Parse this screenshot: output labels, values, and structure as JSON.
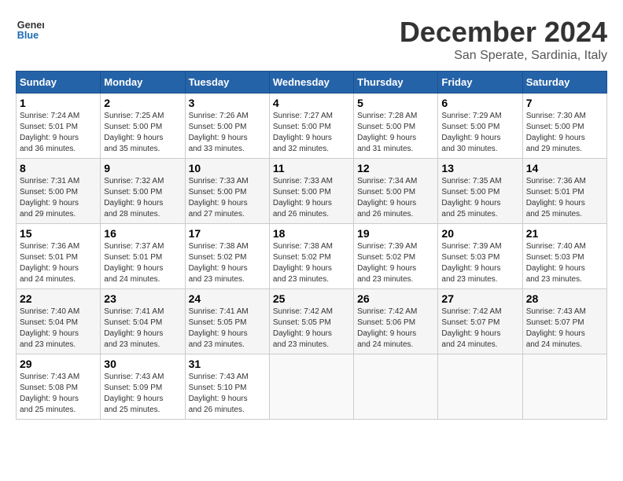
{
  "logo": {
    "line1": "General",
    "line2": "Blue"
  },
  "title": "December 2024",
  "subtitle": "San Sperate, Sardinia, Italy",
  "days_of_week": [
    "Sunday",
    "Monday",
    "Tuesday",
    "Wednesday",
    "Thursday",
    "Friday",
    "Saturday"
  ],
  "weeks": [
    [
      {
        "day": 1,
        "info": "Sunrise: 7:24 AM\nSunset: 5:01 PM\nDaylight: 9 hours\nand 36 minutes."
      },
      {
        "day": 2,
        "info": "Sunrise: 7:25 AM\nSunset: 5:00 PM\nDaylight: 9 hours\nand 35 minutes."
      },
      {
        "day": 3,
        "info": "Sunrise: 7:26 AM\nSunset: 5:00 PM\nDaylight: 9 hours\nand 33 minutes."
      },
      {
        "day": 4,
        "info": "Sunrise: 7:27 AM\nSunset: 5:00 PM\nDaylight: 9 hours\nand 32 minutes."
      },
      {
        "day": 5,
        "info": "Sunrise: 7:28 AM\nSunset: 5:00 PM\nDaylight: 9 hours\nand 31 minutes."
      },
      {
        "day": 6,
        "info": "Sunrise: 7:29 AM\nSunset: 5:00 PM\nDaylight: 9 hours\nand 30 minutes."
      },
      {
        "day": 7,
        "info": "Sunrise: 7:30 AM\nSunset: 5:00 PM\nDaylight: 9 hours\nand 29 minutes."
      }
    ],
    [
      {
        "day": 8,
        "info": "Sunrise: 7:31 AM\nSunset: 5:00 PM\nDaylight: 9 hours\nand 29 minutes."
      },
      {
        "day": 9,
        "info": "Sunrise: 7:32 AM\nSunset: 5:00 PM\nDaylight: 9 hours\nand 28 minutes."
      },
      {
        "day": 10,
        "info": "Sunrise: 7:33 AM\nSunset: 5:00 PM\nDaylight: 9 hours\nand 27 minutes."
      },
      {
        "day": 11,
        "info": "Sunrise: 7:33 AM\nSunset: 5:00 PM\nDaylight: 9 hours\nand 26 minutes."
      },
      {
        "day": 12,
        "info": "Sunrise: 7:34 AM\nSunset: 5:00 PM\nDaylight: 9 hours\nand 26 minutes."
      },
      {
        "day": 13,
        "info": "Sunrise: 7:35 AM\nSunset: 5:00 PM\nDaylight: 9 hours\nand 25 minutes."
      },
      {
        "day": 14,
        "info": "Sunrise: 7:36 AM\nSunset: 5:01 PM\nDaylight: 9 hours\nand 25 minutes."
      }
    ],
    [
      {
        "day": 15,
        "info": "Sunrise: 7:36 AM\nSunset: 5:01 PM\nDaylight: 9 hours\nand 24 minutes."
      },
      {
        "day": 16,
        "info": "Sunrise: 7:37 AM\nSunset: 5:01 PM\nDaylight: 9 hours\nand 24 minutes."
      },
      {
        "day": 17,
        "info": "Sunrise: 7:38 AM\nSunset: 5:02 PM\nDaylight: 9 hours\nand 23 minutes."
      },
      {
        "day": 18,
        "info": "Sunrise: 7:38 AM\nSunset: 5:02 PM\nDaylight: 9 hours\nand 23 minutes."
      },
      {
        "day": 19,
        "info": "Sunrise: 7:39 AM\nSunset: 5:02 PM\nDaylight: 9 hours\nand 23 minutes."
      },
      {
        "day": 20,
        "info": "Sunrise: 7:39 AM\nSunset: 5:03 PM\nDaylight: 9 hours\nand 23 minutes."
      },
      {
        "day": 21,
        "info": "Sunrise: 7:40 AM\nSunset: 5:03 PM\nDaylight: 9 hours\nand 23 minutes."
      }
    ],
    [
      {
        "day": 22,
        "info": "Sunrise: 7:40 AM\nSunset: 5:04 PM\nDaylight: 9 hours\nand 23 minutes."
      },
      {
        "day": 23,
        "info": "Sunrise: 7:41 AM\nSunset: 5:04 PM\nDaylight: 9 hours\nand 23 minutes."
      },
      {
        "day": 24,
        "info": "Sunrise: 7:41 AM\nSunset: 5:05 PM\nDaylight: 9 hours\nand 23 minutes."
      },
      {
        "day": 25,
        "info": "Sunrise: 7:42 AM\nSunset: 5:05 PM\nDaylight: 9 hours\nand 23 minutes."
      },
      {
        "day": 26,
        "info": "Sunrise: 7:42 AM\nSunset: 5:06 PM\nDaylight: 9 hours\nand 24 minutes."
      },
      {
        "day": 27,
        "info": "Sunrise: 7:42 AM\nSunset: 5:07 PM\nDaylight: 9 hours\nand 24 minutes."
      },
      {
        "day": 28,
        "info": "Sunrise: 7:43 AM\nSunset: 5:07 PM\nDaylight: 9 hours\nand 24 minutes."
      }
    ],
    [
      {
        "day": 29,
        "info": "Sunrise: 7:43 AM\nSunset: 5:08 PM\nDaylight: 9 hours\nand 25 minutes."
      },
      {
        "day": 30,
        "info": "Sunrise: 7:43 AM\nSunset: 5:09 PM\nDaylight: 9 hours\nand 25 minutes."
      },
      {
        "day": 31,
        "info": "Sunrise: 7:43 AM\nSunset: 5:10 PM\nDaylight: 9 hours\nand 26 minutes."
      },
      null,
      null,
      null,
      null
    ]
  ]
}
